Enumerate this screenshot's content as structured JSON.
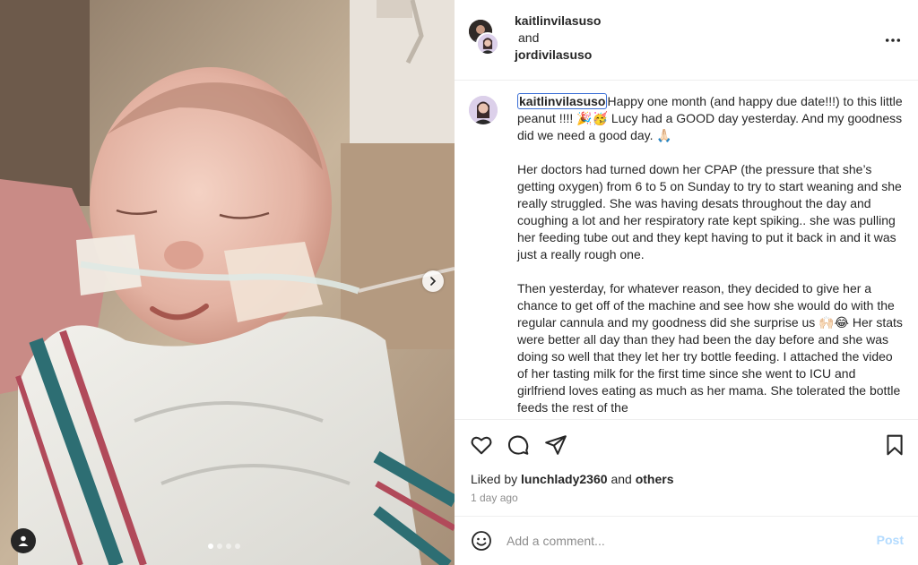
{
  "post": {
    "header": {
      "author_primary": "kaitlinvilasuso",
      "conjunction": "and",
      "author_secondary": "jordivilasuso",
      "more_icon": "more-horizontal-icon"
    },
    "media": {
      "description_icon": "photo",
      "next_icon": "chevron-right-icon",
      "tagged_icon": "user-tag-icon",
      "carousel_dots": 4,
      "carousel_active": 1
    },
    "caption": {
      "username": "kaitlinvilasuso",
      "paragraphs": [
        "Happy one month (and happy due date!!!) to this little peanut !!!! 🎉🥳 Lucy had a GOOD day yesterday. And my goodness did we need a good day. 🙏🏻",
        "Her doctors had turned down her CPAP (the pressure that she’s getting oxygen) from 6 to 5 on Sunday to try to start weaning and she really struggled. She was having desats throughout the day and coughing a lot and her respiratory rate kept spiking.. she was pulling her feeding tube out and they kept having to put it back in and it was just a really rough one.",
        "Then yesterday, for whatever reason, they decided to give her a chance to get off of the machine and see how she would do with the regular cannula and my goodness did she surprise us 🙌🏻😂 Her stats were better all day than they had been the day before and she was doing so well that they let her try bottle feeding. I attached the video of her tasting milk for the first time since she went to ICU and girlfriend loves eating as much as her mama. She tolerated the bottle feeds the rest of the"
      ]
    },
    "actions": {
      "like_icon": "heart-icon",
      "comment_icon": "comment-icon",
      "share_icon": "send-icon",
      "save_icon": "bookmark-icon"
    },
    "likes": {
      "prefix": "Liked by",
      "user": "lunchlady2360",
      "joiner": "and",
      "others": "others"
    },
    "timestamp": "1 day ago",
    "comment": {
      "emoji_icon": "smile-icon",
      "placeholder": "Add a comment...",
      "post_label": "Post"
    }
  },
  "colors": {
    "text": "#262626",
    "secondary_text": "#8e8e8e",
    "divider": "#efefef",
    "post_disabled": "#b3dbff",
    "caption_user_outline": "#3b6fd6"
  }
}
